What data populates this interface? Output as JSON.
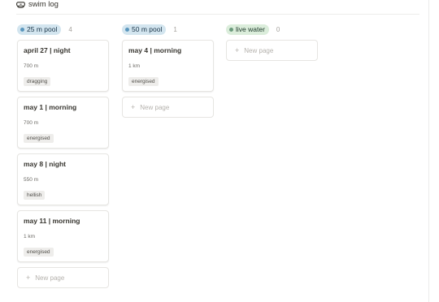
{
  "board": {
    "title": "swim log",
    "icon": "goggles-icon"
  },
  "colors": {
    "pool25_bg": "#d3e5ef",
    "pool25_dot": "#5b97bd",
    "pool50_bg": "#d3e5ef",
    "pool50_dot": "#5b97bd",
    "live_bg": "#dbeddb",
    "live_dot": "#6c9b7d",
    "tag_bg": "#eeedeb"
  },
  "columns": [
    {
      "label": "25 m pool",
      "count": "4",
      "cards": [
        {
          "title": "april 27 | night",
          "distance": "700 m",
          "tag": "dragging"
        },
        {
          "title": "may 1 | morning",
          "distance": "700 m",
          "tag": "energised"
        },
        {
          "title": "may 8 | night",
          "distance": "550 m",
          "tag": "hellish"
        },
        {
          "title": "may 11 | morning",
          "distance": "1 km",
          "tag": "energised"
        }
      ],
      "new_page_label": "New page"
    },
    {
      "label": "50 m pool",
      "count": "1",
      "cards": [
        {
          "title": "may 4 | morning",
          "distance": "1 km",
          "tag": "energised"
        }
      ],
      "new_page_label": "New page"
    },
    {
      "label": "live water",
      "count": "0",
      "cards": [],
      "new_page_label": "New page"
    }
  ]
}
